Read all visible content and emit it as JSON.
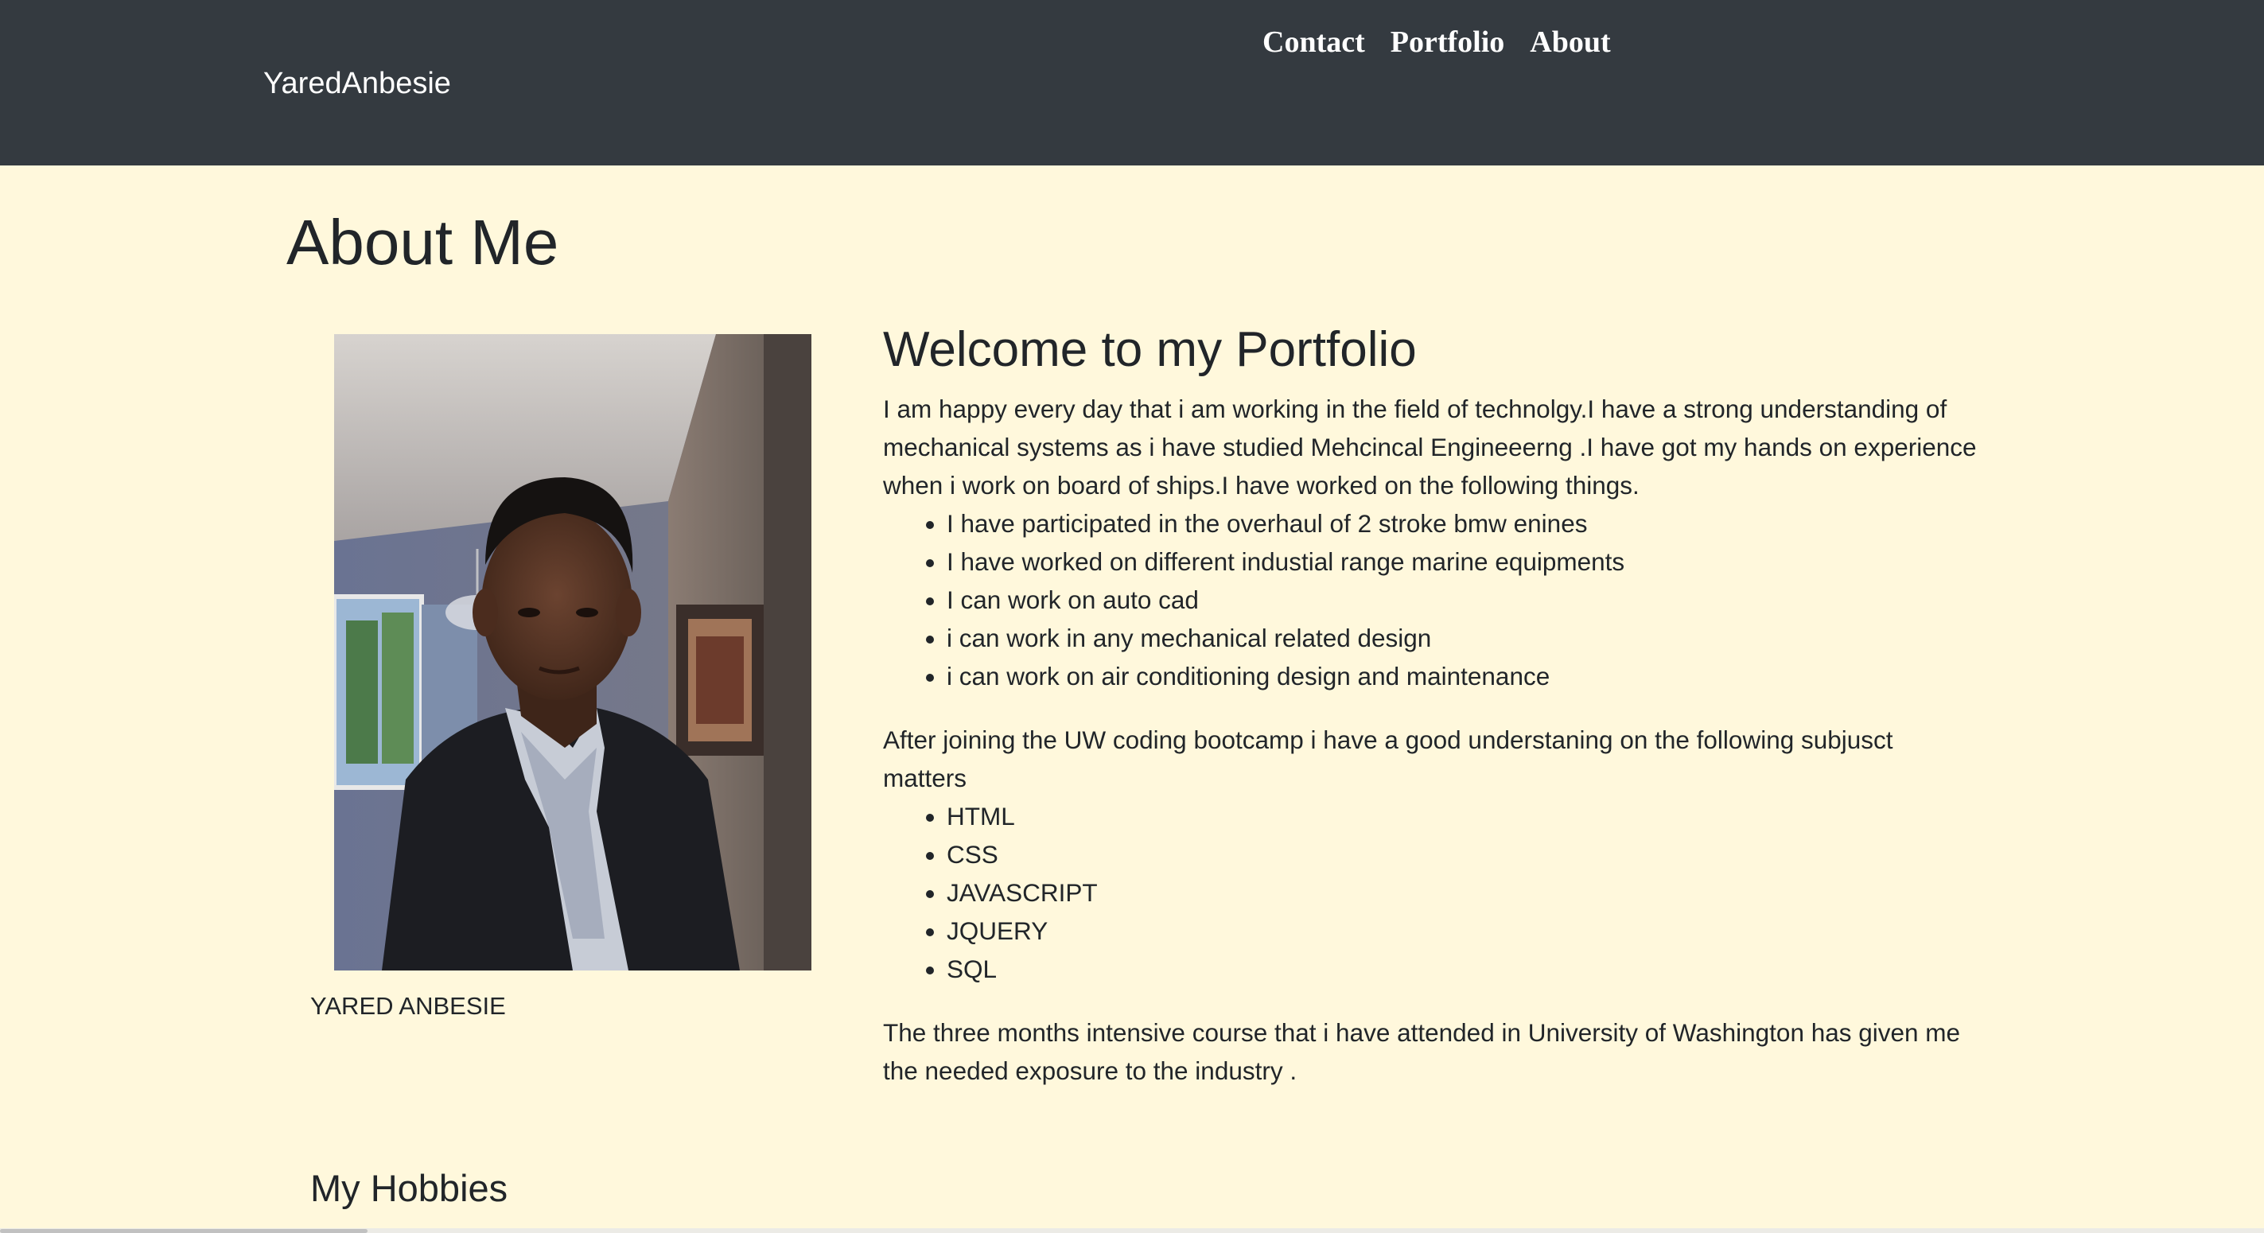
{
  "navbar": {
    "brand": "YaredAnbesie",
    "links": [
      {
        "label": "Contact"
      },
      {
        "label": "Portfolio"
      },
      {
        "label": "About"
      }
    ]
  },
  "page": {
    "title": "About Me"
  },
  "profile": {
    "caption": "YARED ANBESIE"
  },
  "content": {
    "heading": "Welcome to my Portfolio",
    "intro": "I am happy every day that i am working in the field of technolgy.I have a strong understanding of mechanical systems as i have studied Mehcincal Engineeerng .I have got my hands on experience when i work on board of ships.I have worked on the following things.",
    "experience": [
      "I have participated in the overhaul of 2 stroke bmw enines",
      "I have worked on different industial range marine equipments",
      "I can work on auto cad",
      "i can work in any mechanical related design",
      "i can work on air conditioning design and maintenance"
    ],
    "bootcamp_intro": "After joining the UW coding bootcamp i have a good understaning on the following subjusct matters",
    "skills": [
      "HTML",
      "CSS",
      "JAVASCRIPT",
      "JQUERY",
      "SQL"
    ],
    "closing": "The three months intensive course that i have attended in University of Washington has given me the needed exposure to the industry ."
  },
  "hobbies": {
    "heading": "My Hobbies"
  },
  "colors": {
    "navbar_bg": "#343a40",
    "page_bg": "#fff8dc",
    "text": "#212529"
  }
}
